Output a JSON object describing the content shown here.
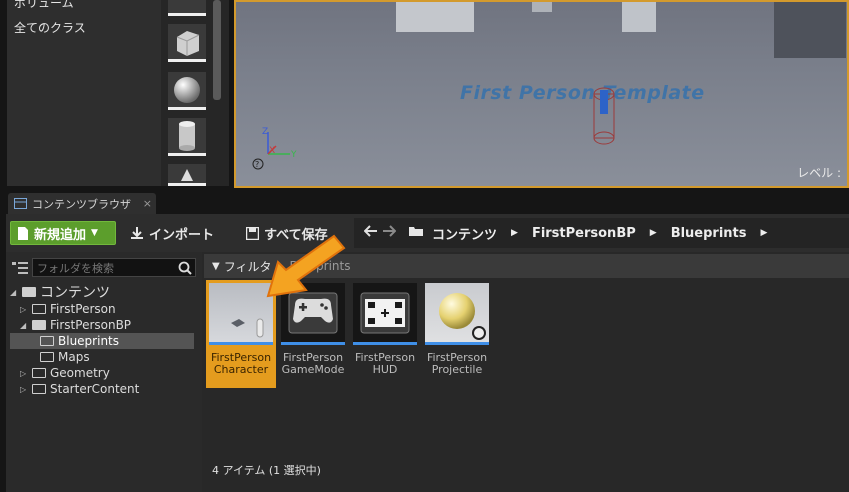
{
  "class_panel": {
    "partial_label": "ボリューム",
    "all_classes": "全てのクラス"
  },
  "viewport": {
    "template_text": "First Person Template",
    "level_label": "レベル :"
  },
  "tab": {
    "label": "コンテンツブラウザ",
    "close": "×"
  },
  "toolbar": {
    "add_new": "新規追加",
    "import": "インポート",
    "save_all": "すべて保存",
    "breadcrumb": [
      "コンテンツ",
      "FirstPersonBP",
      "Blueprints"
    ]
  },
  "tree": {
    "search_placeholder": "フォルダを検索",
    "items": [
      {
        "label": "コンテンツ"
      },
      {
        "label": "FirstPerson"
      },
      {
        "label": "FirstPersonBP"
      },
      {
        "label": "Blueprints"
      },
      {
        "label": "Maps"
      },
      {
        "label": "Geometry"
      },
      {
        "label": "StarterContent"
      }
    ]
  },
  "assets": {
    "filter_label": "フィルタ",
    "filter_path": "Blueprints",
    "items": [
      {
        "line1": "FirstPerson",
        "line2": "Character"
      },
      {
        "line1": "FirstPerson",
        "line2": "GameMode"
      },
      {
        "line1": "FirstPerson",
        "line2": "HUD"
      },
      {
        "line1": "FirstPerson",
        "line2": "Projectile"
      }
    ],
    "count_text": "4 アイテム (1 選択中)"
  },
  "colors": {
    "accent": "#e49c1e",
    "add_button": "#5c9e2c",
    "thumb_underline": "#3f8fe8"
  }
}
